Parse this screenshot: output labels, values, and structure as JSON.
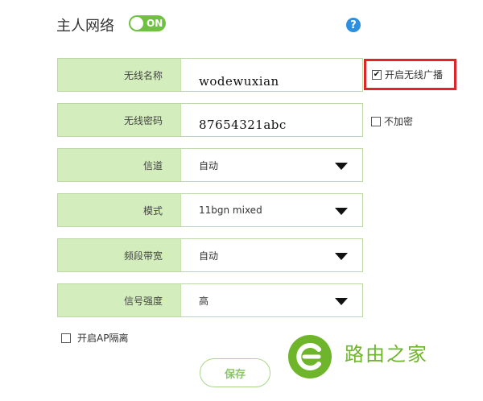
{
  "header": {
    "title": "主人网络",
    "toggle_label": "ON",
    "help_glyph": "?"
  },
  "form": {
    "rows": [
      {
        "label": "无线名称",
        "value": "wodewuxian"
      },
      {
        "label": "无线密码",
        "value": "87654321abc"
      },
      {
        "label": "信道",
        "value": "自动"
      },
      {
        "label": "模式",
        "value": "11bgn mixed"
      },
      {
        "label": "频段带宽",
        "value": "自动"
      },
      {
        "label": "信号强度",
        "value": "高"
      }
    ]
  },
  "options": {
    "broadcast": {
      "label": "开启无线广播",
      "checked": true
    },
    "no_encrypt": {
      "label": "不加密",
      "checked": false
    },
    "ap_isolate": {
      "label": "开启AP隔离",
      "checked": false
    }
  },
  "actions": {
    "save_label": "保存"
  },
  "watermark": {
    "text": "路由之家"
  },
  "colors": {
    "accent_green": "#6fc241",
    "label_bg": "#d3eebc",
    "highlight_red": "#e3232a",
    "help_blue": "#2d8fe0"
  }
}
